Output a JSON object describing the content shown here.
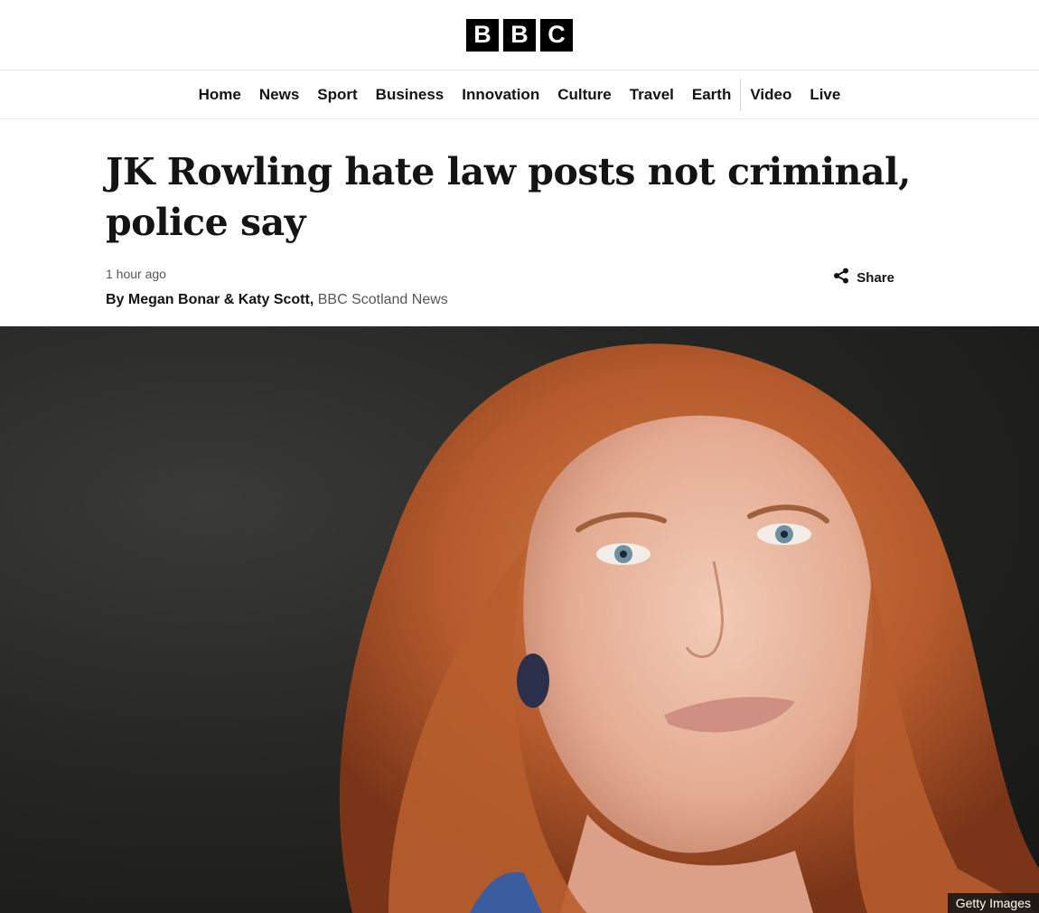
{
  "brand": {
    "logo_letters": [
      "B",
      "B",
      "C"
    ]
  },
  "nav": {
    "items": [
      "Home",
      "News",
      "Sport",
      "Business",
      "Innovation",
      "Culture",
      "Travel",
      "Earth"
    ],
    "items_after_separator": [
      "Video",
      "Live"
    ]
  },
  "article": {
    "headline": "JK Rowling hate law posts not criminal, police say",
    "timestamp": "1 hour ago",
    "byline_authors": "By Megan Bonar & Katy Scott,",
    "byline_org": "BBC Scotland News",
    "share_label": "Share"
  },
  "hero_image": {
    "credit": "Getty Images",
    "subject": "portrait-photo"
  },
  "icons": {
    "share": "share-icon"
  },
  "colors": {
    "text": "#141414",
    "muted": "#545658",
    "divider": "#e6e8ea",
    "logo": "#000000"
  }
}
